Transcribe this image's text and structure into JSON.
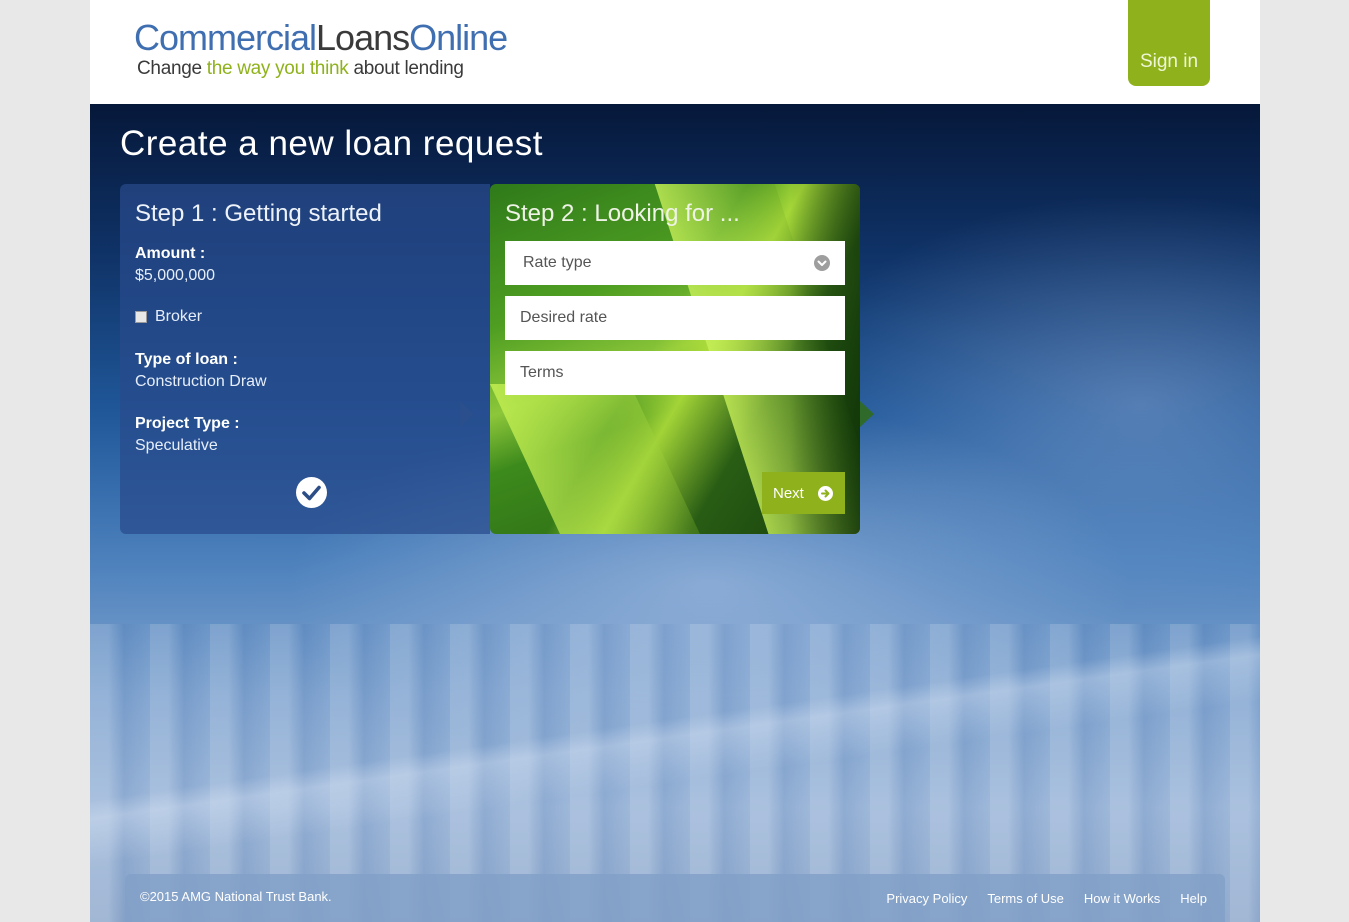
{
  "header": {
    "logo_part1": "Commercial",
    "logo_part2": "Loans",
    "logo_part3": "Online",
    "tagline_part1": "Change ",
    "tagline_part2": "the way you think",
    "tagline_part3": " about lending",
    "signin_label": "Sign in"
  },
  "page_title": "Create a new loan request",
  "step1": {
    "title": "Step 1 : Getting started",
    "amount_label": "Amount :",
    "amount_value": "$5,000,000",
    "broker_label": "Broker",
    "broker_checked": false,
    "loan_type_label": "Type of loan :",
    "loan_type_value": "Construction Draw",
    "project_type_label": "Project Type :",
    "project_type_value": "Speculative"
  },
  "step2": {
    "title": "Step 2 : Looking for ...",
    "rate_type_placeholder": "Rate type",
    "desired_rate_placeholder": "Desired rate",
    "terms_placeholder": "Terms",
    "next_label": "Next"
  },
  "footer": {
    "copyright": "©2015 AMG National Trust Bank.",
    "links": [
      "Privacy Policy",
      "Terms of Use",
      "How it Works",
      "Help"
    ]
  },
  "colors": {
    "brand_blue": "#3f6fb1",
    "brand_green": "#8fb21c",
    "text_dark": "#3a3a3a"
  }
}
